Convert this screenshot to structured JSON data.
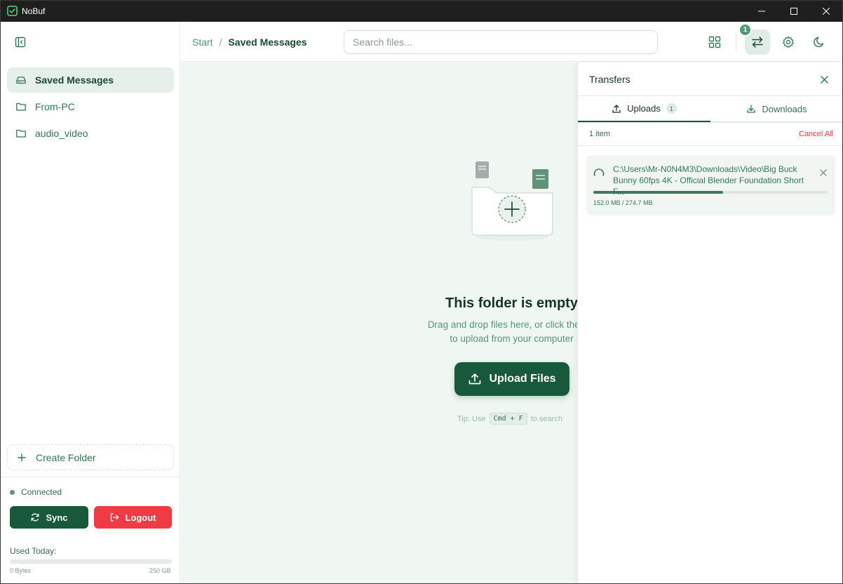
{
  "window": {
    "title": "NoBuf"
  },
  "sidebar": {
    "items": [
      {
        "label": "Saved Messages",
        "icon": "drive-icon",
        "active": true
      },
      {
        "label": "From-PC",
        "icon": "folder-icon",
        "active": false
      },
      {
        "label": "audio_video",
        "icon": "folder-icon",
        "active": false
      }
    ],
    "create_folder_label": "Create Folder",
    "status_label": "Connected",
    "sync_label": "Sync",
    "logout_label": "Logout",
    "used_today_label": "Used Today:",
    "usage": {
      "fraction": 0.0,
      "min_label": "0 Bytes",
      "max_label": "250 GB"
    }
  },
  "header": {
    "breadcrumb": {
      "start": "Start",
      "separator": "/",
      "current": "Saved Messages"
    },
    "search_placeholder": "Search files...",
    "transfer_badge": "1"
  },
  "main": {
    "empty_title": "This folder is empty",
    "empty_line1": "Drag and drop files here, or click the but",
    "empty_line2": "to upload from your computer",
    "upload_label": "Upload Files",
    "tip_prefix": "Tip: Use",
    "tip_kbd": "Cmd + F",
    "tip_suffix": "to search"
  },
  "transfers": {
    "title": "Transfers",
    "tabs": {
      "uploads": "Uploads",
      "uploads_count": "1",
      "downloads": "Downloads"
    },
    "item_count": "1 item",
    "cancel_all": "Cancel All",
    "items": [
      {
        "file": "C:\\Users\\Mr-N0N4M3\\Downloads\\Video\\Big Buck Bunny 60fps 4K - Official Blender Foundation Short F...",
        "progress_fraction": 0.553,
        "size_text": "152.0 MB / 274.7 MB"
      }
    ]
  },
  "colors": {
    "accent": "#17593a",
    "accent_light": "#4f9a73",
    "danger": "#f03a44",
    "main_bg": "#f0f7f3"
  }
}
